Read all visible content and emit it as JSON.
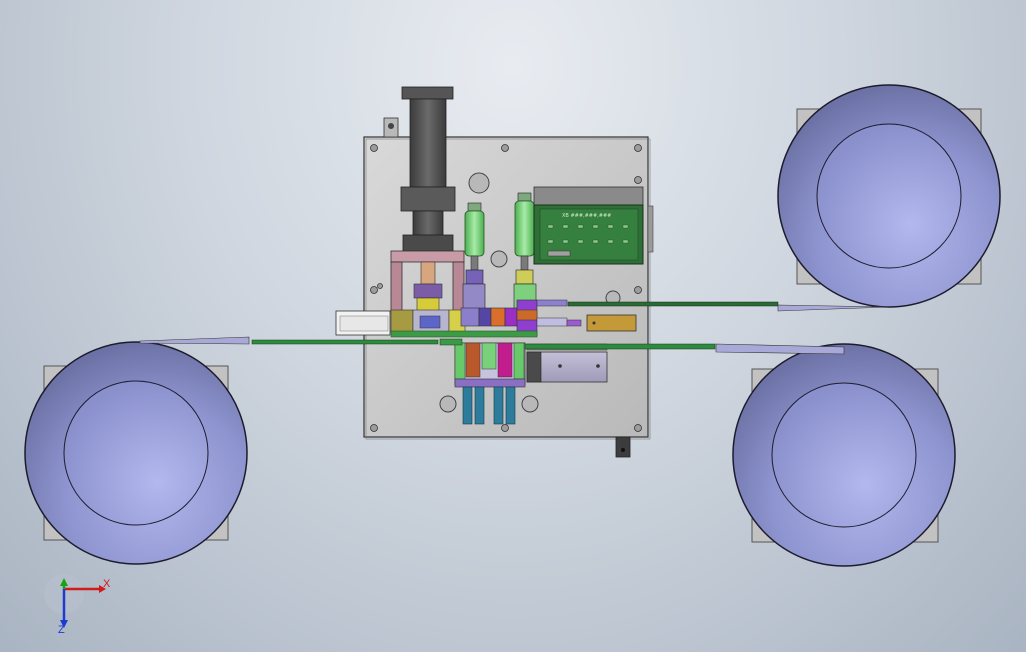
{
  "triad": {
    "x_label": "X",
    "z_label": "Z",
    "x_color": "#d01b1b",
    "y_color": "#16a316",
    "z_color": "#1d3bd0"
  },
  "controller_board": {
    "label": "XB  ###,###,###"
  },
  "colors": {
    "background_top": "#e8ecf1",
    "background_bottom": "#a9b4c2",
    "reel_face": "#8f95cf",
    "reel_hub": "#9ea4dc",
    "plate": "#c9c9c9",
    "cylinder": "#4a4a4a",
    "pneumatic_green": "#7ed47e",
    "board_green": "#2c6e35",
    "strip_green": "#2e8a3e"
  }
}
